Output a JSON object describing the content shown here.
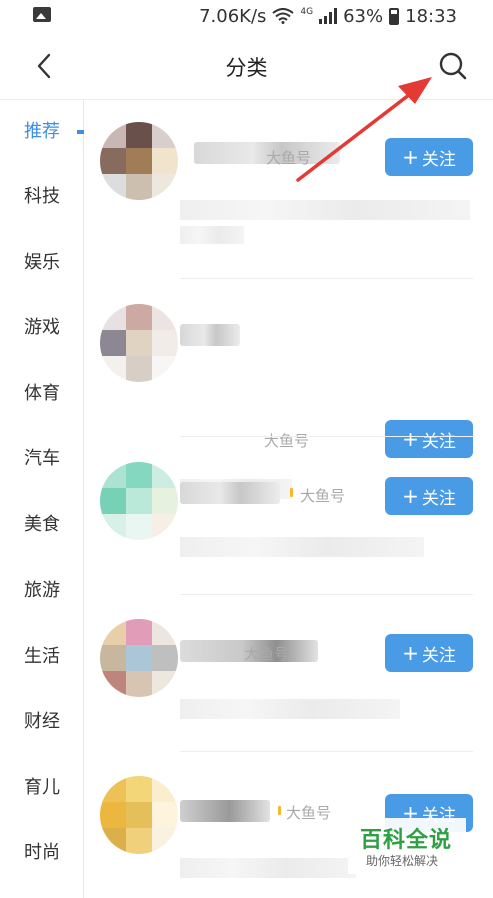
{
  "status_bar": {
    "speed": "7.06K/s",
    "network": "4G",
    "battery": "63%",
    "time": "18:33"
  },
  "header": {
    "title": "分类",
    "back_icon": "chevron-left-icon",
    "search_icon": "search-icon"
  },
  "sidebar": {
    "items": [
      {
        "label": "推荐",
        "active": true
      },
      {
        "label": "科技"
      },
      {
        "label": "娱乐"
      },
      {
        "label": "游戏"
      },
      {
        "label": "体育"
      },
      {
        "label": "汽车"
      },
      {
        "label": "美食"
      },
      {
        "label": "旅游"
      },
      {
        "label": "生活"
      },
      {
        "label": "财经"
      },
      {
        "label": "育儿"
      },
      {
        "label": "时尚"
      }
    ]
  },
  "cards": [
    {
      "tag": "大鱼号",
      "follow": "关注"
    },
    {
      "tag": "大鱼号",
      "follow": "关注"
    },
    {
      "tag": "大鱼号",
      "follow": "关注"
    },
    {
      "tag": "大鱼号",
      "follow": "关注"
    },
    {
      "tag": "大鱼号",
      "follow": "关注"
    }
  ],
  "watermark": {
    "main": "百科全说",
    "sub": "助你轻松解决"
  },
  "colors": {
    "accent": "#3d8fe8",
    "follow_button": "#4a9be6",
    "arrow": "#e53935",
    "watermark": "#2ea043"
  }
}
